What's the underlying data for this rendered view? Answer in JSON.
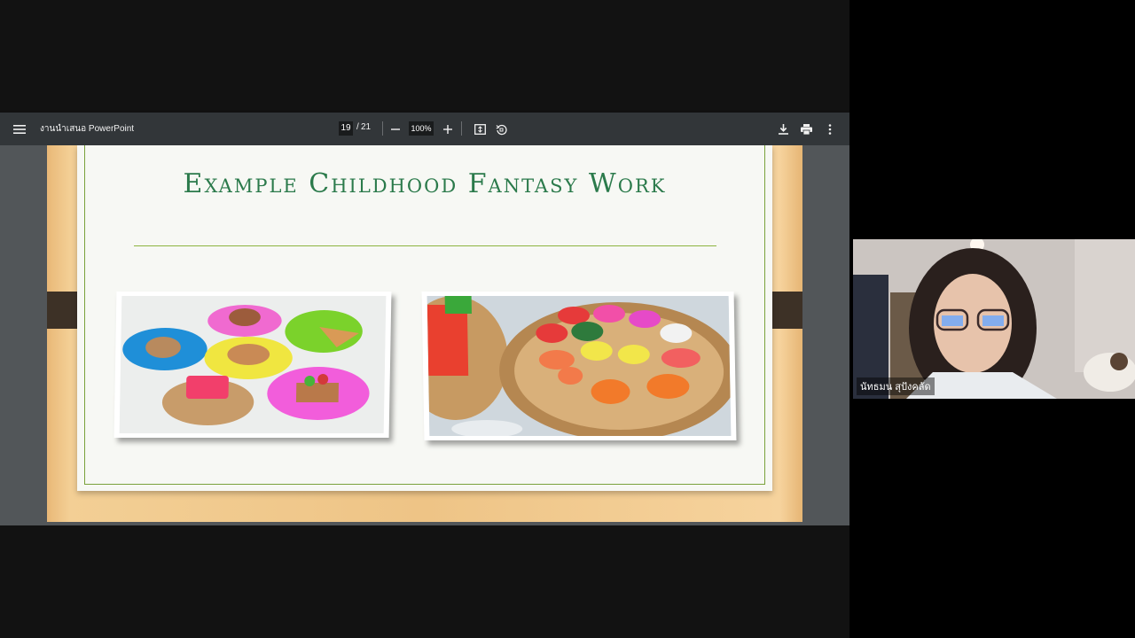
{
  "viewer": {
    "document_title": "งานนำเสนอ PowerPoint",
    "current_page": "19",
    "page_separator": "/",
    "total_pages": "21",
    "zoom": "100%",
    "icons": {
      "menu": "menu-icon",
      "zoom_out": "minus-icon",
      "zoom_in": "plus-icon",
      "fit": "fit-page-icon",
      "rotate": "rotate-icon",
      "download": "download-icon",
      "print": "print-icon",
      "more": "more-vert-icon"
    }
  },
  "slide": {
    "title": "Example  Childhood Fantasy Work",
    "photos": [
      {
        "subject": "clay-food-plates-image"
      },
      {
        "subject": "clay-sushi-basket-image"
      }
    ]
  },
  "participant": {
    "name": "นัทธมน สุปังคลัด"
  },
  "colors": {
    "toolbar": "#323639",
    "canvas": "#525659",
    "title_green": "#2b7a4b",
    "rule_green": "#8db43f"
  }
}
